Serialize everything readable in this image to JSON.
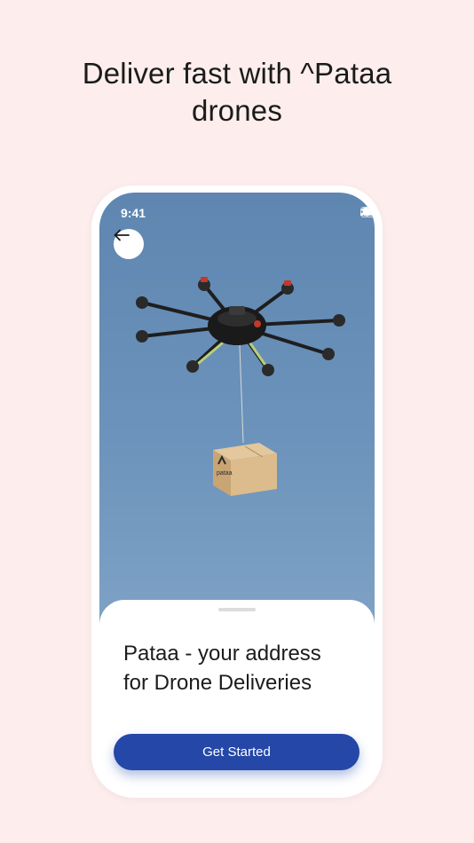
{
  "headline": {
    "line1": "Deliver fast with ^Pataa",
    "line2": "drones"
  },
  "status_bar": {
    "time": "9:41",
    "icons": [
      "signal-icon",
      "wifi-icon",
      "battery-icon"
    ]
  },
  "nav": {
    "back_icon": "arrow-left-icon"
  },
  "photo": {
    "subject": "drone-with-package",
    "package_label": "pataa"
  },
  "sheet": {
    "title_line1": "Pataa - your address",
    "title_line2": "for Drone Deliveries",
    "button_label": "Get Started"
  },
  "colors": {
    "background": "#fdeeed",
    "primary": "#2447a8",
    "sky": "#6c93bb"
  }
}
